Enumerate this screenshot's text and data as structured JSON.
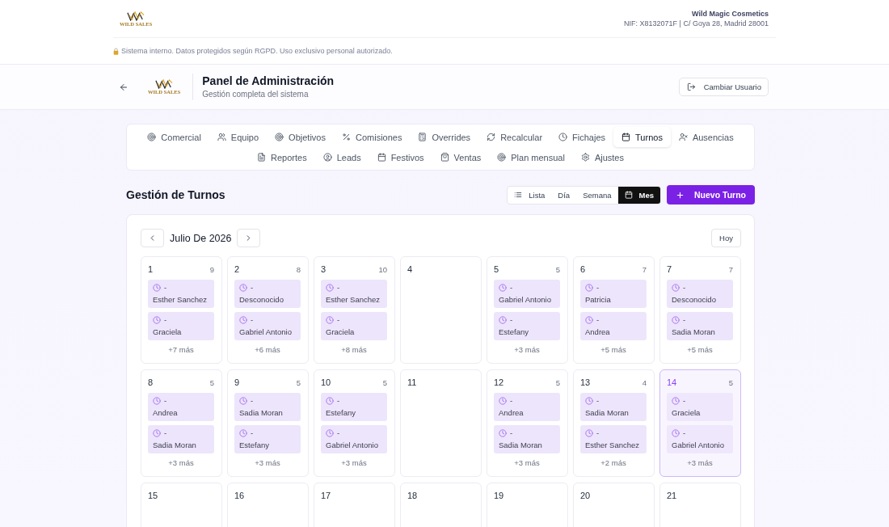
{
  "top_bar": {
    "logo_text": "WILD SALES",
    "company_name": "Wild Magic Cosmetics",
    "company_details": "NIF: X8132071F | C/ Goya 28, Madrid 28001",
    "notice": "Sistema interno. Datos protegidos según RGPD. Uso exclusivo personal autorizado."
  },
  "admin_header": {
    "logo_text": "WILD SALES",
    "title": "Panel de Administración",
    "subtitle": "Gestión completa del sistema",
    "switch_user_button": "Cambiar Usuario"
  },
  "tab_rows": [
    [
      {
        "label": "Comercial",
        "selected": false
      },
      {
        "label": "Equipo",
        "selected": false
      },
      {
        "label": "Objetivos",
        "selected": false
      },
      {
        "label": "Comisiones",
        "selected": false
      },
      {
        "label": "Overrides",
        "selected": false
      },
      {
        "label": "Recalcular",
        "selected": false
      },
      {
        "label": "Fichajes",
        "selected": false
      },
      {
        "label": "Turnos",
        "selected": true
      },
      {
        "label": "Ausencias",
        "selected": false
      }
    ],
    [
      {
        "label": "Reportes",
        "selected": false
      },
      {
        "label": "Leads",
        "selected": false
      },
      {
        "label": "Festivos",
        "selected": false
      },
      {
        "label": "Ventas",
        "selected": false
      },
      {
        "label": "Plan mensual",
        "selected": false
      },
      {
        "label": "Ajustes",
        "selected": false
      }
    ]
  ],
  "section": {
    "title": "Gestión de Turnos",
    "views": [
      {
        "label": "Lista",
        "selected": false
      },
      {
        "label": "Día",
        "selected": false
      },
      {
        "label": "Semana",
        "selected": false
      },
      {
        "label": "Mes",
        "selected": true
      }
    ],
    "new_button": "Nuevo Turno"
  },
  "calendar": {
    "month_label": "Julio De 2026",
    "today_button": "Hoy",
    "weeks": [
      [
        {
          "day": "1",
          "count": "9",
          "shifts": [
            {
              "time": "-",
              "name": "Esther Sanchez"
            },
            {
              "time": "-",
              "name": "Graciela"
            }
          ],
          "more": "+7 más",
          "today": false
        },
        {
          "day": "2",
          "count": "8",
          "shifts": [
            {
              "time": "-",
              "name": "Desconocido"
            },
            {
              "time": "-",
              "name": "Gabriel Antonio"
            }
          ],
          "more": "+6 más",
          "today": false
        },
        {
          "day": "3",
          "count": "10",
          "shifts": [
            {
              "time": "-",
              "name": "Esther Sanchez"
            },
            {
              "time": "-",
              "name": "Graciela"
            }
          ],
          "more": "+8 más",
          "today": false
        },
        {
          "day": "4",
          "today": false
        },
        {
          "day": "5",
          "count": "5",
          "shifts": [
            {
              "time": "-",
              "name": "Gabriel Antonio"
            },
            {
              "time": "-",
              "name": "Estefany"
            }
          ],
          "more": "+3 más",
          "today": false
        },
        {
          "day": "6",
          "count": "7",
          "shifts": [
            {
              "time": "-",
              "name": "Patricia"
            },
            {
              "time": "-",
              "name": "Andrea"
            }
          ],
          "more": "+5 más",
          "today": false
        },
        {
          "day": "7",
          "count": "7",
          "shifts": [
            {
              "time": "-",
              "name": "Desconocido"
            },
            {
              "time": "-",
              "name": "Sadia Moran"
            }
          ],
          "more": "+5 más",
          "today": false
        }
      ],
      [
        {
          "day": "8",
          "count": "5",
          "shifts": [
            {
              "time": "-",
              "name": "Andrea"
            },
            {
              "time": "-",
              "name": "Sadia Moran"
            }
          ],
          "more": "+3 más",
          "today": false
        },
        {
          "day": "9",
          "count": "5",
          "shifts": [
            {
              "time": "-",
              "name": "Sadia Moran"
            },
            {
              "time": "-",
              "name": "Estefany"
            }
          ],
          "more": "+3 más",
          "today": false
        },
        {
          "day": "10",
          "count": "5",
          "shifts": [
            {
              "time": "-",
              "name": "Estefany"
            },
            {
              "time": "-",
              "name": "Gabriel Antonio"
            }
          ],
          "more": "+3 más",
          "today": false
        },
        {
          "day": "11",
          "today": false
        },
        {
          "day": "12",
          "count": "5",
          "shifts": [
            {
              "time": "-",
              "name": "Andrea"
            },
            {
              "time": "-",
              "name": "Sadia Moran"
            }
          ],
          "more": "+3 más",
          "today": false
        },
        {
          "day": "13",
          "count": "4",
          "shifts": [
            {
              "time": "-",
              "name": "Sadia Moran"
            },
            {
              "time": "-",
              "name": "Esther Sanchez"
            }
          ],
          "more": "+2 más",
          "today": false
        },
        {
          "day": "14",
          "count": "5",
          "shifts": [
            {
              "time": "-",
              "name": "Graciela"
            },
            {
              "time": "-",
              "name": "Gabriel Antonio"
            }
          ],
          "more": "+3 más",
          "today": true
        }
      ],
      [
        {
          "day": "15",
          "today": false
        },
        {
          "day": "16",
          "today": false
        },
        {
          "day": "17",
          "today": false
        },
        {
          "day": "18",
          "today": false
        },
        {
          "day": "19",
          "today": false
        },
        {
          "day": "20",
          "today": false
        },
        {
          "day": "21",
          "today": false
        }
      ]
    ]
  }
}
